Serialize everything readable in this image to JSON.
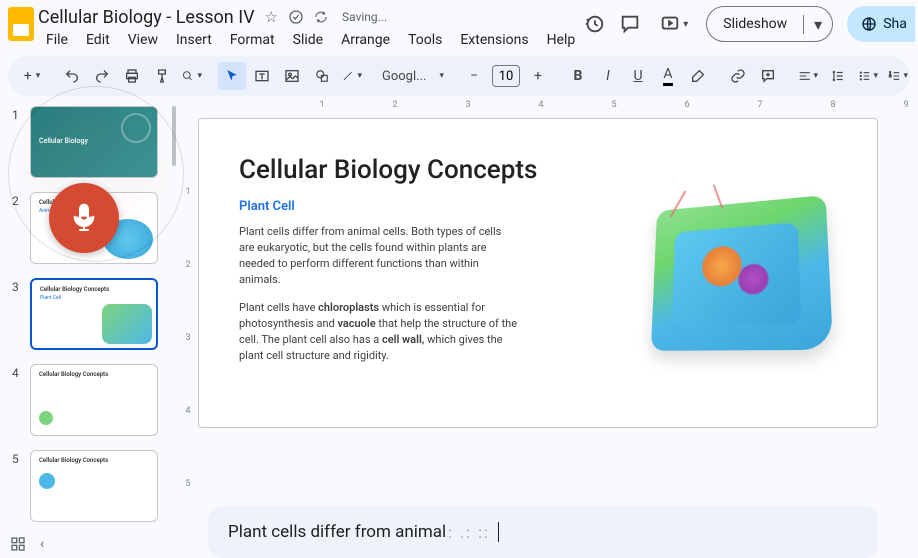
{
  "header": {
    "title": "Cellular Biology - Lesson IV",
    "saving": "Saving...",
    "menu": [
      "File",
      "Edit",
      "View",
      "Insert",
      "Format",
      "Slide",
      "Arrange",
      "Tools",
      "Extensions",
      "Help"
    ],
    "slideshow": "Slideshow",
    "share": "Sha"
  },
  "toolbar": {
    "font_name": "Googl...",
    "font_size": "10"
  },
  "ruler_h": [
    "1",
    "2",
    "3",
    "4",
    "5",
    "6",
    "7",
    "8",
    "9"
  ],
  "ruler_v": [
    "",
    "1",
    "2",
    "3",
    "4",
    "5"
  ],
  "thumbs": [
    {
      "num": "1",
      "title": "Cellular Biology"
    },
    {
      "num": "2",
      "title": "Cellular Biology Concepts"
    },
    {
      "num": "3",
      "title": "Cellular Biology Concepts"
    },
    {
      "num": "4",
      "title": "Cellular Biology Concepts"
    },
    {
      "num": "5",
      "title": "Cellular Biology Concepts"
    }
  ],
  "slide": {
    "title": "Cellular Biology Concepts",
    "subtitle": "Plant Cell",
    "p1": "Plant cells differ from animal cells. Both types of cells are eukaryotic, but the cells found within plants are needed to perform different functions than within animals.",
    "p2a": "Plant cells have ",
    "p2b": "chloroplasts",
    "p2c": " which is essential for photosynthesis and ",
    "p2d": "vacuole",
    "p2e": " that help the structure of the cell. The plant cell also has a ",
    "p2f": "cell wall,",
    "p2g": " which gives the plant cell structure and rigidity."
  },
  "caption": {
    "text": "Plant cells differ from animal",
    "dots": ": .: ::"
  }
}
